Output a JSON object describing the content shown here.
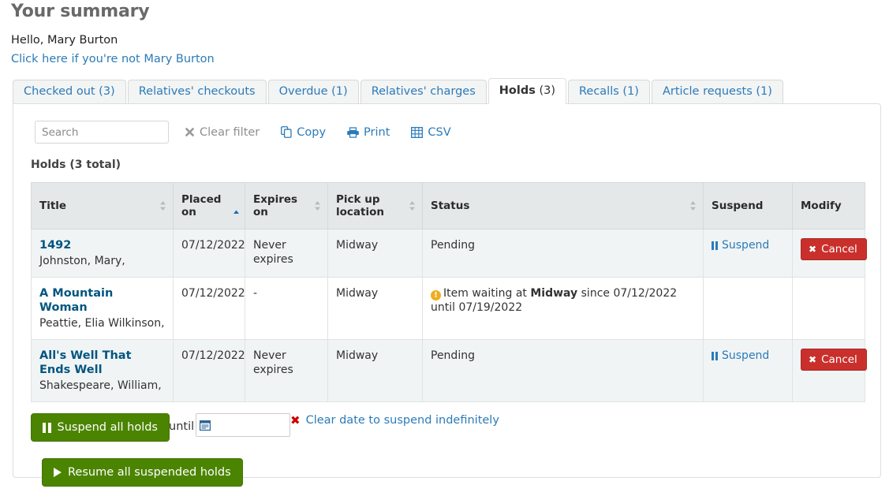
{
  "header": {
    "title": "Your summary",
    "greeting": "Hello, Mary Burton",
    "not_you_link": "Click here if you're not Mary Burton"
  },
  "tabs": [
    {
      "label": "Checked out (3)",
      "main": "Checked out",
      "count": "(3)",
      "active": false
    },
    {
      "label": "Relatives' checkouts",
      "main": "Relatives' checkouts",
      "count": "",
      "active": false
    },
    {
      "label": "Overdue (1)",
      "main": "Overdue",
      "count": "(1)",
      "active": false
    },
    {
      "label": "Relatives' charges",
      "main": "Relatives' charges",
      "count": "",
      "active": false
    },
    {
      "label": "Holds (3)",
      "main": "Holds",
      "count": "(3)",
      "active": true
    },
    {
      "label": "Recalls (1)",
      "main": "Recalls",
      "count": "(1)",
      "active": false
    },
    {
      "label": "Article requests (1)",
      "main": "Article requests",
      "count": "(1)",
      "active": false
    }
  ],
  "toolbar": {
    "search_placeholder": "Search",
    "search_value": "",
    "clear_filter": "Clear filter",
    "copy": "Copy",
    "print": "Print",
    "csv": "CSV"
  },
  "table": {
    "caption": "Holds (3 total)",
    "columns": [
      {
        "label": "Title",
        "sort": "none"
      },
      {
        "label": "Placed on",
        "sort": "asc"
      },
      {
        "label": "Expires on",
        "sort": "none"
      },
      {
        "label": "Pick up location",
        "sort": "none"
      },
      {
        "label": "Status",
        "sort": "none"
      },
      {
        "label": "Suspend",
        "sort": null
      },
      {
        "label": "Modify",
        "sort": null
      }
    ],
    "rows": [
      {
        "title": "1492",
        "author": "Johnston, Mary,",
        "placed_on": "07/12/2022",
        "expires_on": "Never expires",
        "pickup": "Midway",
        "status_kind": "plain",
        "status_text": "Pending",
        "status_prefix": "",
        "status_location": "",
        "status_suffix": "",
        "suspend": "Suspend",
        "modify": "Cancel"
      },
      {
        "title": "A Mountain Woman",
        "author": "Peattie, Elia Wilkinson,",
        "placed_on": "07/12/2022",
        "expires_on": "-",
        "pickup": "Midway",
        "status_kind": "waiting",
        "status_text": "",
        "status_prefix": "Item waiting at",
        "status_location": "Midway",
        "status_suffix": "since 07/12/2022 until 07/19/2022",
        "suspend": "",
        "modify": ""
      },
      {
        "title": "All's Well That Ends Well",
        "author": "Shakespeare, William,",
        "placed_on": "07/12/2022",
        "expires_on": "Never expires",
        "pickup": "Midway",
        "status_kind": "plain",
        "status_text": "Pending",
        "status_prefix": "",
        "status_location": "",
        "status_suffix": "",
        "suspend": "Suspend",
        "modify": "Cancel"
      }
    ]
  },
  "controls": {
    "suspend_all": "Suspend all holds",
    "until": "until",
    "date_value": "",
    "clear_date": "Clear date to suspend indefinitely",
    "resume_all": "Resume all suspended holds"
  },
  "colors": {
    "link": "#2b7bb9",
    "title_link": "#005580",
    "green": "#4b8400",
    "red": "#c9302c",
    "warn": "#f0ad20",
    "header_bg": "#e4e8e8",
    "stripe": "#f1f4f4"
  }
}
